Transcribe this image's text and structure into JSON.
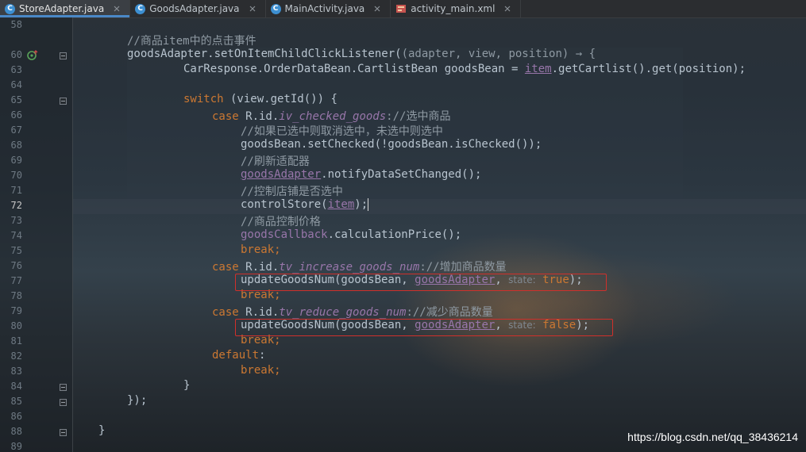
{
  "tabs": [
    {
      "label": "StoreAdapter.java",
      "icon": "java-class-icon",
      "active": true
    },
    {
      "label": "GoodsAdapter.java",
      "icon": "java-class-icon",
      "active": false
    },
    {
      "label": "MainActivity.java",
      "icon": "java-class-icon",
      "active": false
    },
    {
      "label": "activity_main.xml",
      "icon": "xml-layout-icon",
      "active": false
    }
  ],
  "tab_icon_letter": "C",
  "line_numbers": [
    "58",
    "60",
    "63",
    "64",
    "65",
    "66",
    "67",
    "68",
    "69",
    "70",
    "71",
    "72",
    "73",
    "74",
    "75",
    "76",
    "77",
    "78",
    "79",
    "80",
    "81",
    "82",
    "83",
    "84",
    "85",
    "86",
    "88",
    "89"
  ],
  "current_line": "72",
  "code": {
    "l58": "",
    "l60_comment": "//商品item中的点击事件",
    "l60a": "goodsAdapter.setOnItemChildClickListener(",
    "l60b": "(adapter, view, position) → {",
    "l63a": "CarResponse.OrderDataBean.CartlistBean goodsBean = ",
    "l63b": "item",
    "l63c": ".getCartlist().get(position);",
    "l65a": "switch",
    "l65b": " (view.getId()) {",
    "l66a": "case",
    "l66b": " R.id.",
    "l66c": "iv_checked_goods",
    "l66d": "://选中商品",
    "l67": "//如果已选中则取消选中，未选中则选中",
    "l68": "goodsBean.setChecked(!goodsBean.isChecked());",
    "l69": "//刷新适配器",
    "l70a": "goodsAdapter",
    "l70b": ".notifyDataSetChanged();",
    "l71": "//控制店铺是否选中",
    "l72a": "controlStore(",
    "l72b": "item",
    "l72c": ");",
    "l73": "//商品控制价格",
    "l74a": "goodsCallback",
    "l74b": ".calculationPrice();",
    "brk": "break",
    "semi": ";",
    "l76a": "case",
    "l76b": " R.id.",
    "l76c": "tv_increase_goods_num",
    "l76d": "://增加商品数量",
    "upd": "updateGoodsNum(goodsBean, ",
    "ga": "goodsAdapter",
    "comma": ", ",
    "state_hint": "state:",
    "true_val": "true",
    "false_val": "false",
    "close": ");",
    "l79a": "case",
    "l79b": " R.id.",
    "l79c": "tv_reduce_goods_num",
    "l79d": "://减少商品数量",
    "l82": "default",
    "colon": ":",
    "l84": "}",
    "l85": "});",
    "l88": "}"
  },
  "watermark": "https://blog.csdn.net/qq_38436214",
  "colors": {
    "keyword": "#cc7832",
    "field": "#9876aa",
    "comment": "#8f9aa3",
    "highlight_box": "#d0302b",
    "tab_accent": "#4a88c7"
  }
}
